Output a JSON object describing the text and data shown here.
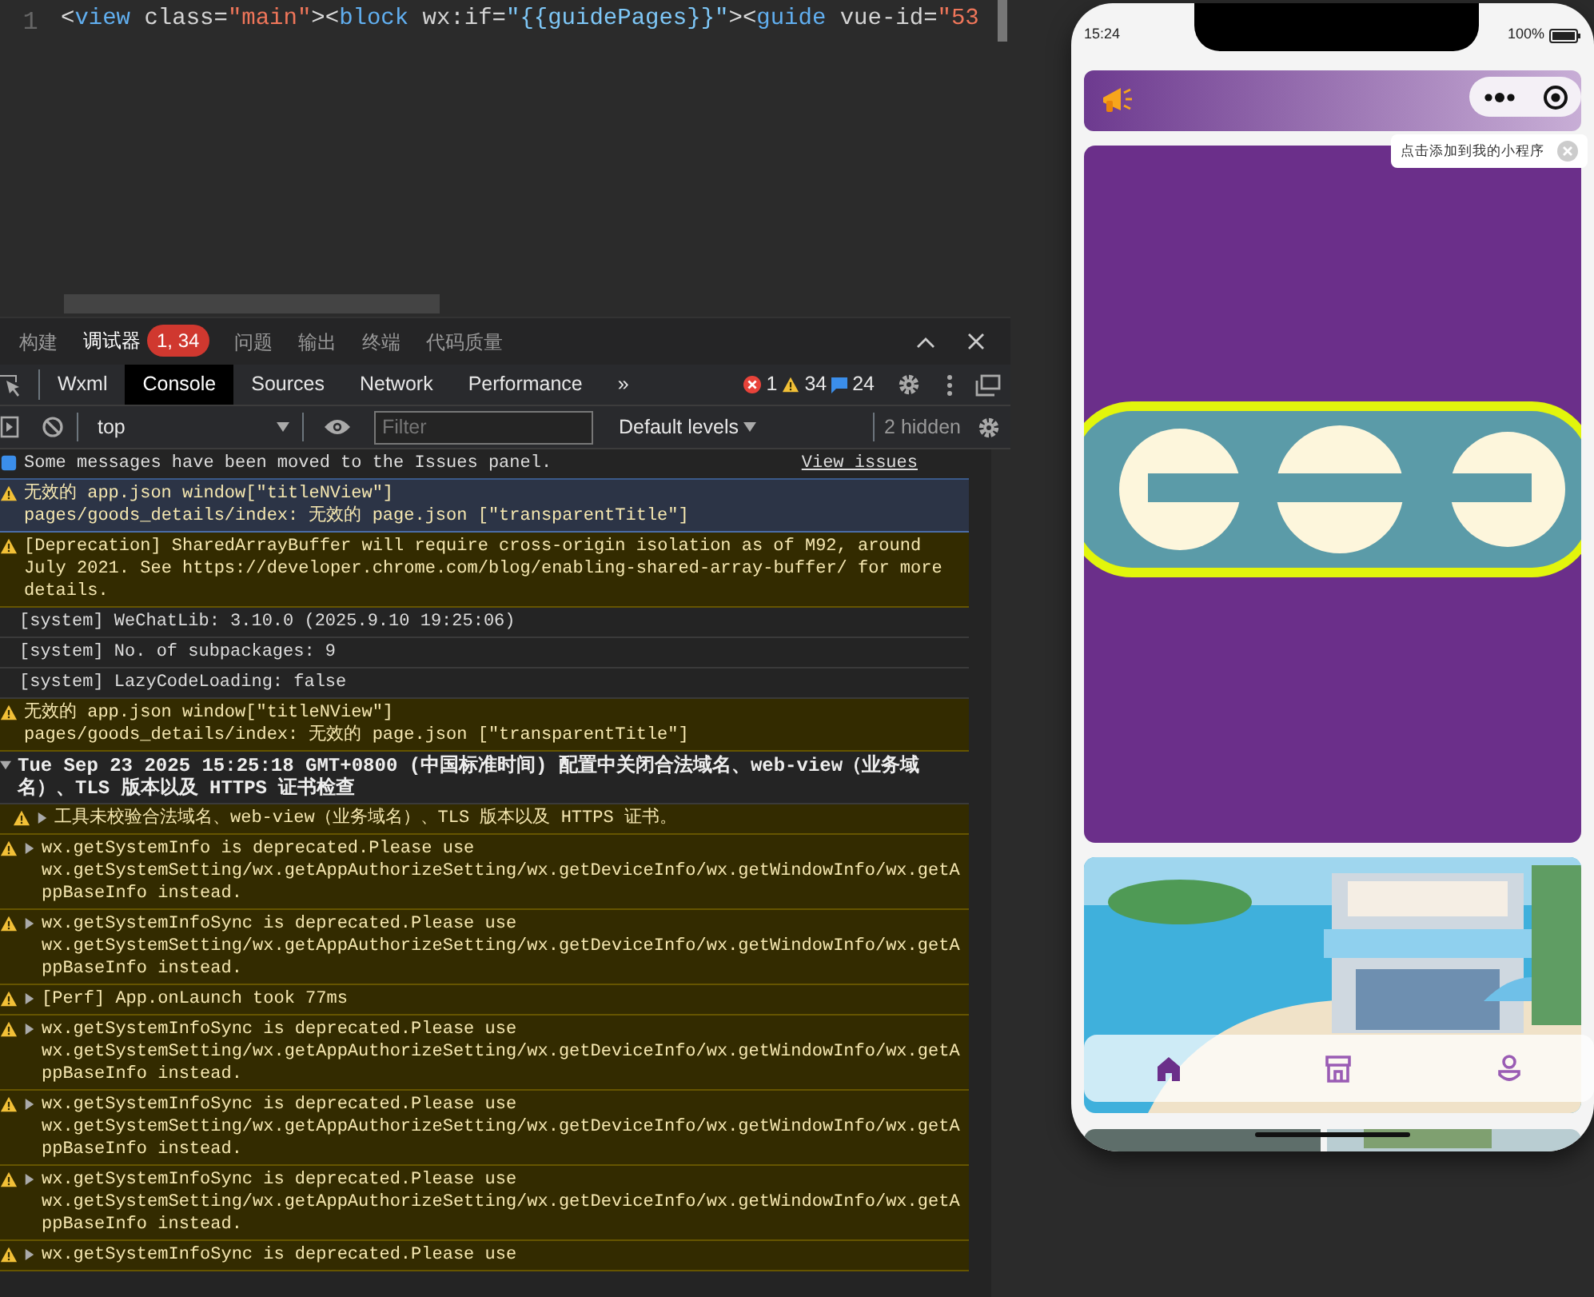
{
  "editor": {
    "line_number": "1",
    "tokens": [
      {
        "kind": "punct",
        "text": "<"
      },
      {
        "kind": "tag",
        "text": "view"
      },
      {
        "kind": "attr",
        "text": " class="
      },
      {
        "kind": "string",
        "text": "\"main\""
      },
      {
        "kind": "punct",
        "text": ">"
      },
      {
        "kind": "punct",
        "text": "<"
      },
      {
        "kind": "tag",
        "text": "block"
      },
      {
        "kind": "attr",
        "text": " wx:if="
      },
      {
        "kind": "expr",
        "text": "\"{{guidePages}}\""
      },
      {
        "kind": "punct",
        "text": ">"
      },
      {
        "kind": "punct",
        "text": "<"
      },
      {
        "kind": "tag",
        "text": "guide"
      },
      {
        "kind": "attr",
        "text": " vue-id="
      },
      {
        "kind": "string",
        "text": "\"53"
      }
    ]
  },
  "panel_tabs": [
    {
      "label": "构建",
      "selected": false
    },
    {
      "label": "调试器",
      "selected": true,
      "badge": "1, 34"
    },
    {
      "label": "问题",
      "selected": false
    },
    {
      "label": "输出",
      "selected": false
    },
    {
      "label": "终端",
      "selected": false
    },
    {
      "label": "代码质量",
      "selected": false
    }
  ],
  "devtools_tabs": [
    {
      "label": "Wxml",
      "selected": false
    },
    {
      "label": "Console",
      "selected": true
    },
    {
      "label": "Sources",
      "selected": false
    },
    {
      "label": "Network",
      "selected": false
    },
    {
      "label": "Performance",
      "selected": false
    }
  ],
  "more_tabs": "»",
  "counts": {
    "errors": "1",
    "warnings": "34",
    "messages": "24"
  },
  "toolbar": {
    "context": "top",
    "filter_placeholder": "Filter",
    "levels": "Default levels",
    "hidden": "2 hidden"
  },
  "console": [
    {
      "kind": "info",
      "text": "Some messages have been moved to the Issues panel.",
      "link": "View issues"
    },
    {
      "kind": "warning",
      "selected": true,
      "text": "无效的 app.json window[\"titleNView\"]\npages/goods_details/index: 无效的 page.json [\"transparentTitle\"]"
    },
    {
      "kind": "warning",
      "selected": false,
      "text": "[Deprecation] SharedArrayBuffer will require cross-origin isolation as of M92, around July 2021. See ",
      "link": "https://developer.chrome.com/blog/enabling-shared-array-buffer/",
      "text_after": " for more details."
    },
    {
      "kind": "plain",
      "text": "[system] WeChatLib: 3.10.0 (2025.9.10 19:25:06)"
    },
    {
      "kind": "plain",
      "text": "[system] No. of subpackages: 9"
    },
    {
      "kind": "plain",
      "text": "[system] LazyCodeLoading: false"
    },
    {
      "kind": "warning",
      "selected": false,
      "text": "无效的 app.json window[\"titleNView\"]\npages/goods_details/index: 无效的 page.json [\"transparentTitle\"]"
    },
    {
      "kind": "group",
      "expanded": true,
      "text": "Tue Sep 23 2025 15:25:18 GMT+0800 (中国标准时间) 配置中关闭合法域名、web-view（业务域名）、TLS 版本以及 HTTPS 证书检查"
    },
    {
      "kind": "warning",
      "selected": false,
      "nested": true,
      "expandable": true,
      "text": "工具未校验合法域名、web-view（业务域名）、TLS 版本以及 HTTPS 证书。"
    },
    {
      "kind": "warning",
      "selected": false,
      "expandable": true,
      "text": "wx.getSystemInfo is deprecated.Please use wx.getSystemSetting/wx.getAppAuthorizeSetting/wx.getDeviceInfo/wx.getWindowInfo/wx.getAppBaseInfo instead."
    },
    {
      "kind": "warning",
      "selected": false,
      "expandable": true,
      "text": "wx.getSystemInfoSync is deprecated.Please use wx.getSystemSetting/wx.getAppAuthorizeSetting/wx.getDeviceInfo/wx.getWindowInfo/wx.getAppBaseInfo instead."
    },
    {
      "kind": "warning",
      "selected": false,
      "expandable": true,
      "text": "[Perf] App.onLaunch took 77ms"
    },
    {
      "kind": "warning",
      "selected": false,
      "expandable": true,
      "text": "wx.getSystemInfoSync is deprecated.Please use wx.getSystemSetting/wx.getAppAuthorizeSetting/wx.getDeviceInfo/wx.getWindowInfo/wx.getAppBaseInfo instead."
    },
    {
      "kind": "warning",
      "selected": false,
      "expandable": true,
      "text": "wx.getSystemInfoSync is deprecated.Please use wx.getSystemSetting/wx.getAppAuthorizeSetting/wx.getDeviceInfo/wx.getWindowInfo/wx.getAppBaseInfo instead."
    },
    {
      "kind": "warning",
      "selected": false,
      "expandable": true,
      "text": "wx.getSystemInfoSync is deprecated.Please use wx.getSystemSetting/wx.getAppAuthorizeSetting/wx.getDeviceInfo/wx.getWindowInfo/wx.getAppBaseInfo instead."
    },
    {
      "kind": "warning",
      "selected": false,
      "expandable": true,
      "text": "wx.getSystemInfoSync is deprecated.Please use"
    }
  ],
  "phone": {
    "time": "15:24",
    "battery": "100%",
    "tooltip": "点击添加到我的小程序",
    "tab_bar": [
      {
        "selected": true
      },
      {
        "selected": false
      },
      {
        "selected": false
      }
    ]
  }
}
